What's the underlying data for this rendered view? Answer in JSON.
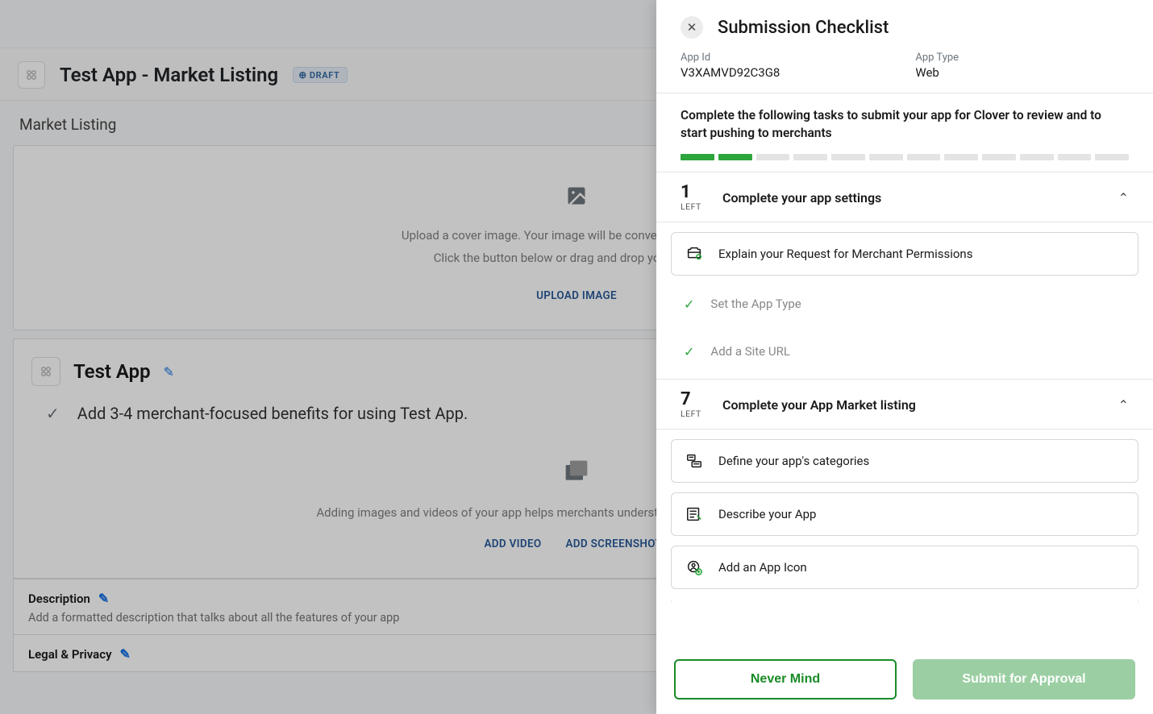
{
  "page": {
    "title": "Test App - Market Listing",
    "draft_badge": "DRAFT",
    "section_title": "Market Listing",
    "cover": {
      "line1": "Upload a cover image. Your image will be converted to a PNG file.",
      "line2": "Click the button below or drag and drop your file here.",
      "upload_label": "UPLOAD IMAGE"
    },
    "app_name": "Test App",
    "benefits_prompt": "Add 3-4 merchant-focused benefits for using Test App.",
    "media": {
      "desc": "Adding images and videos of your app helps merchants understand how they can use it, and tend",
      "add_video": "ADD VIDEO",
      "add_screens": "ADD SCREENSHOTS"
    },
    "description": {
      "title": "Description",
      "sub": "Add a formatted description that talks about all the features of your app"
    },
    "legal": {
      "title": "Legal & Privacy"
    }
  },
  "panel": {
    "title": "Submission Checklist",
    "meta": {
      "app_id_label": "App Id",
      "app_id": "V3XAMVD92C3G8",
      "app_type_label": "App Type",
      "app_type": "Web"
    },
    "instruction": "Complete the following tasks to submit your app for Clover to review and to start pushing to merchants",
    "progress_done": 2,
    "progress_total": 12,
    "left_label": "LEFT",
    "sections": [
      {
        "count": "1",
        "title": "Complete your app settings",
        "tasks": [
          {
            "label": "Explain your Request for Merchant Permissions",
            "done": false,
            "icon": "permissions"
          },
          {
            "label": "Set the App Type",
            "done": true
          },
          {
            "label": "Add a Site URL",
            "done": true
          }
        ]
      },
      {
        "count": "7",
        "title": "Complete your App Market listing",
        "tasks": [
          {
            "label": "Define your app's categories",
            "done": false,
            "icon": "categories"
          },
          {
            "label": "Describe your App",
            "done": false,
            "icon": "describe"
          },
          {
            "label": "Add an App Icon",
            "done": false,
            "icon": "icon"
          }
        ]
      }
    ],
    "footer": {
      "cancel": "Never Mind",
      "submit": "Submit for Approval"
    }
  }
}
